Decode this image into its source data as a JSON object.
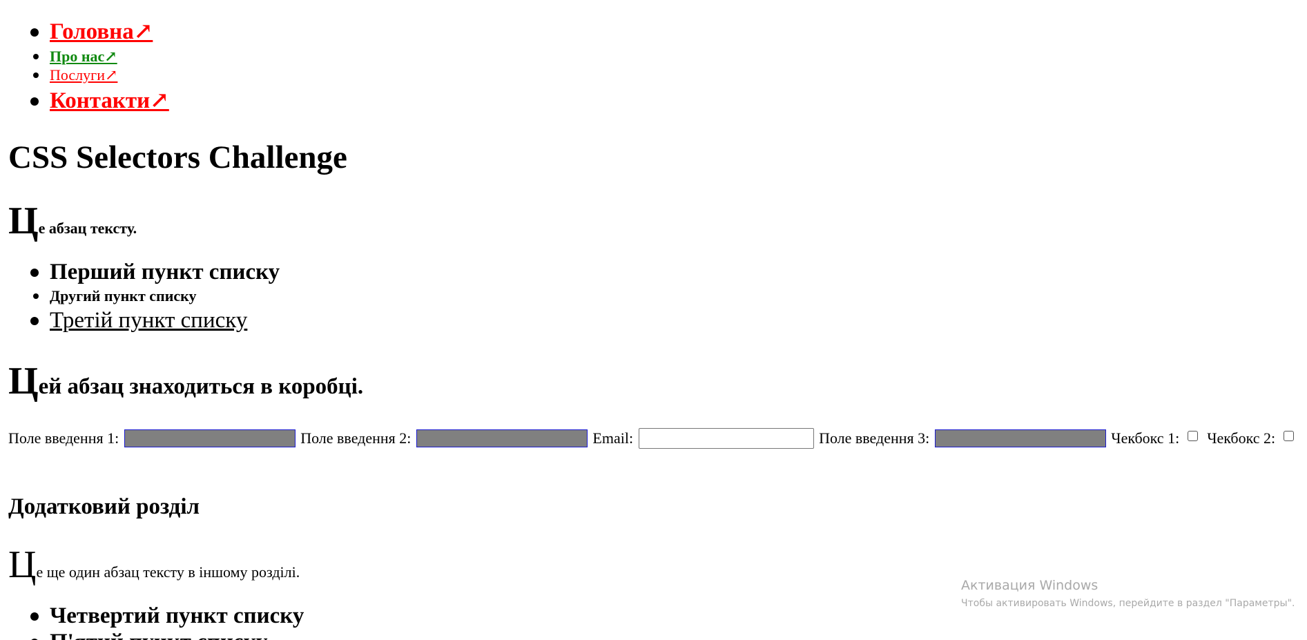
{
  "nav": {
    "items": [
      {
        "label": "Головна↗"
      },
      {
        "label": "Про нас↗"
      },
      {
        "label": "Послуги↗"
      },
      {
        "label": "Контакти↗"
      }
    ]
  },
  "main": {
    "title": "CSS Selectors Challenge",
    "paragraph1": {
      "first_letter": "Ц",
      "rest": "е абзац тексту."
    },
    "list1": [
      "Перший пункт списку",
      "Другий пункт списку",
      "Третій пункт списку"
    ],
    "paragraph2": {
      "first_letter": "Ц",
      "rest": "ей абзац знаходиться в коробці."
    },
    "form": {
      "input1_label": "Поле введення 1:",
      "input2_label": "Поле введення 2:",
      "email_label": "Email:",
      "input3_label": "Поле введення 3:",
      "checkbox1_label": "Чекбокс 1:",
      "checkbox2_label": "Чекбокс 2:"
    },
    "section_title": "Додатковий розділ",
    "paragraph3": {
      "first_letter": "Ц",
      "rest": "е ще один абзац тексту в іншому розділі."
    },
    "list2": [
      "Четвертий пункт списку",
      "П'ятий пункт списку"
    ]
  },
  "windows_activation": {
    "title": "Активация Windows",
    "subtitle": "Чтобы активировать Windows, перейдите в раздел \"Параметры\"."
  }
}
